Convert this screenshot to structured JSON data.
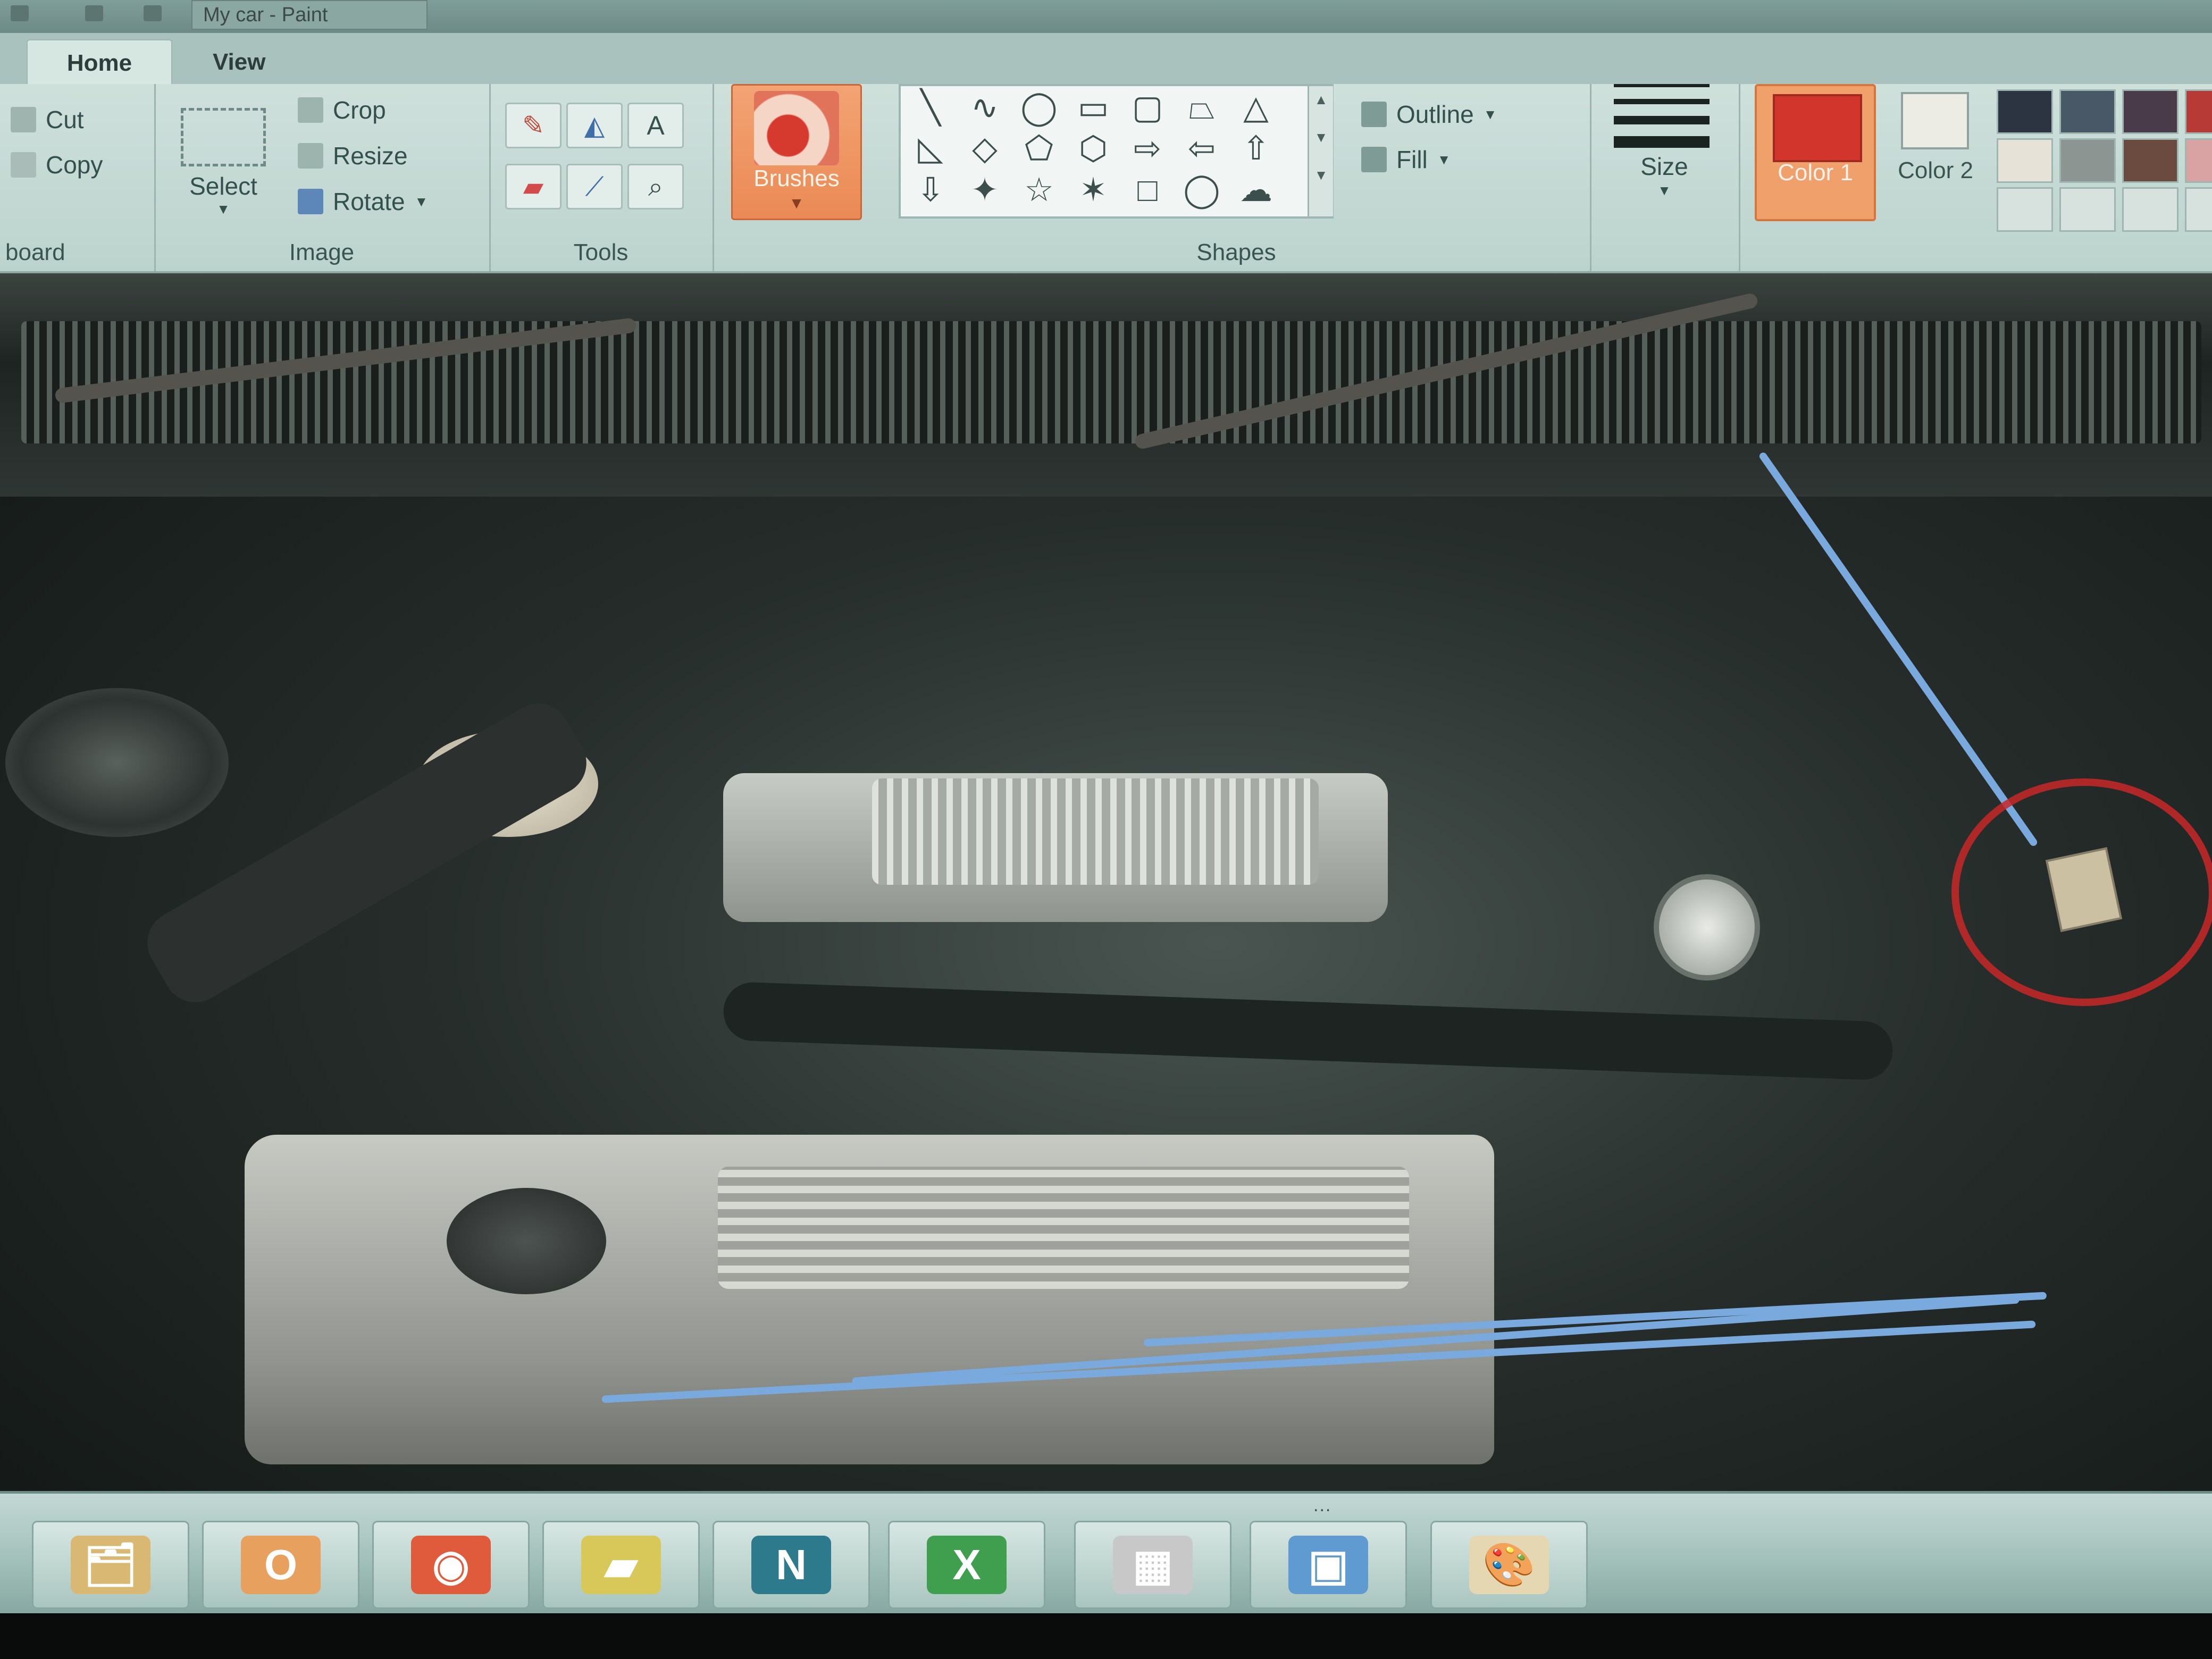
{
  "window": {
    "title": "My car - Paint"
  },
  "tabs": [
    {
      "label": "Home",
      "active": true
    },
    {
      "label": "View",
      "active": false
    }
  ],
  "ribbon": {
    "clipboard": {
      "group_label": "board",
      "cut_label": "Cut",
      "copy_label": "Copy"
    },
    "image": {
      "group_label": "Image",
      "select_label": "Select",
      "crop_label": "Crop",
      "resize_label": "Resize",
      "rotate_label": "Rotate"
    },
    "tools": {
      "group_label": "Tools",
      "items": [
        "pencil-icon",
        "fill-bucket-icon",
        "text-icon",
        "eraser-icon",
        "color-picker-icon",
        "magnifier-icon"
      ]
    },
    "brushes": {
      "label": "Brushes"
    },
    "shapes": {
      "group_label": "Shapes",
      "outline_label": "Outline",
      "fill_label": "Fill",
      "glyphs": [
        "╲",
        "∿",
        "◯",
        "▭",
        "▢",
        "⏢",
        "△",
        "◺",
        "◇",
        "⬠",
        "⬡",
        "⇨",
        "⇦",
        "⇧",
        "⇩",
        "✦",
        "☆",
        "✶",
        "□",
        "◯",
        "☁"
      ]
    },
    "size": {
      "label": "Size"
    },
    "colors": {
      "color1_label": "Color 1",
      "color2_label": "Color 2",
      "color1": "#d2352c",
      "color2": "#ecebe4",
      "palette": [
        "#2c3442",
        "#495866",
        "#4a3b4a",
        "#b83a36",
        "#e6e2d8",
        "#8c9592",
        "#6b4a40",
        "#d9a3a3",
        "#d7e2de",
        "#d7e2de",
        "#d7e2de",
        "#d7e2de"
      ]
    }
  },
  "canvas": {
    "description_icon": "car-engine-photo",
    "annotation_color": "#c82828"
  },
  "taskbar": {
    "grip": "...",
    "apps": [
      {
        "name": "file-explorer-icon",
        "glyph": "🗂"
      },
      {
        "name": "outlook-icon",
        "glyph": "O"
      },
      {
        "name": "chrome-icon",
        "glyph": "◉"
      },
      {
        "name": "sticky-notes-icon",
        "glyph": "▰"
      },
      {
        "name": "netscape-icon",
        "glyph": "N"
      },
      {
        "name": "excel-icon",
        "glyph": "X"
      },
      {
        "name": "calculator-icon",
        "glyph": "▦"
      },
      {
        "name": "photo-viewer-icon",
        "glyph": "▣"
      },
      {
        "name": "paint-icon",
        "glyph": "🎨"
      }
    ]
  }
}
